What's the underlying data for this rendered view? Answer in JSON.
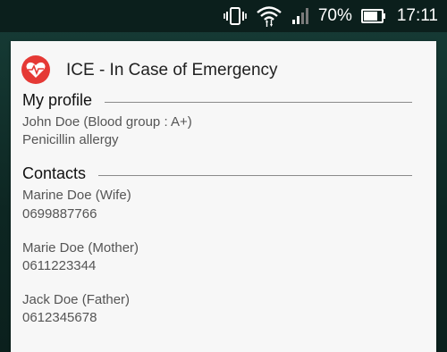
{
  "status_bar": {
    "battery_percent": "70%",
    "time": "17:11",
    "icons": [
      "vibrate-icon",
      "wifi-icon",
      "signal-icon",
      "battery-icon"
    ]
  },
  "app": {
    "title": "ICE - In Case of Emergency",
    "icon": "heart-pulse-icon",
    "accent_color": "#e53935"
  },
  "profile": {
    "heading": "My profile",
    "name_line": "John Doe (Blood group : A+)",
    "allergy": "Penicillin allergy"
  },
  "contacts": {
    "heading": "Contacts",
    "items": [
      {
        "name": "Marine  Doe (Wife)",
        "phone": "0699887766"
      },
      {
        "name": "Marie Doe (Mother)",
        "phone": "0611223344"
      },
      {
        "name": "Jack Doe (Father)",
        "phone": "0612345678"
      }
    ]
  }
}
